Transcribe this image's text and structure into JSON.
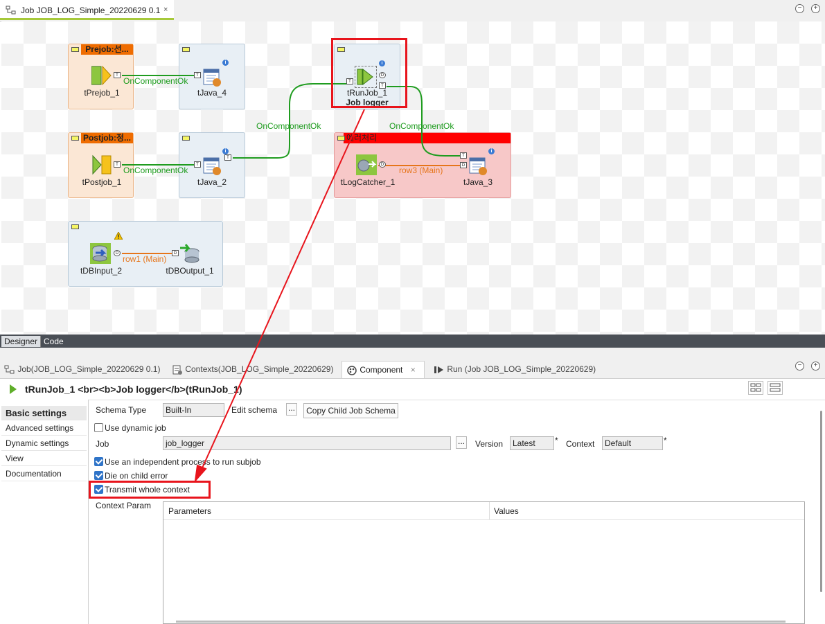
{
  "editor_tab": {
    "title": "Job JOB_LOG_Simple_20220629 0.1",
    "close": "×"
  },
  "window_buttons": {
    "minimize": "−",
    "maximize": "+"
  },
  "canvas": {
    "subjobs": {
      "prejob_title": "Prejob:선...",
      "postjob_title": "Postjob:정...",
      "error_title": "에러처리"
    },
    "components": {
      "tPrejob_1": "tPrejob_1",
      "tJava_4": "tJava_4",
      "tRunJob_1": "tRunJob_1",
      "tRunJob_1_sub": "Job logger",
      "tPostjob_1": "tPostjob_1",
      "tJava_2": "tJava_2",
      "tLogCatcher_1": "tLogCatcher_1",
      "tJava_3": "tJava_3",
      "tDBInput_2": "tDBInput_2",
      "tDBOutput_1": "tDBOutput_1"
    },
    "connections": {
      "pre_ok": "OnComponentOk",
      "post_ok": "OnComponentOk",
      "java2_ok": "OnComponentOk",
      "run_ok": "OnComponentOk",
      "row3": "row3 (Main)",
      "row1": "row1 (Main)"
    },
    "ports": {
      "trigger": "T",
      "data": "D",
      "info": "i"
    },
    "colors": {
      "green_link": "#1f9c1f",
      "orange_link": "#e6751a",
      "highlight_red": "#e8141c",
      "error_header": "#ff0000",
      "pre_header": "#ef6c00"
    }
  },
  "designer_tabs": {
    "designer": "Designer",
    "code": "Code"
  },
  "view_tabs": {
    "job": "Job(JOB_LOG_Simple_20220629 0.1)",
    "contexts": "Contexts(JOB_LOG_Simple_20220629)",
    "component": "Component",
    "component_close": "×",
    "run": "Run (Job JOB_LOG_Simple_20220629)"
  },
  "component_title": "tRunJob_1 <br><b>Job logger</b>(tRunJob_1)",
  "nav": {
    "basic": "Basic settings",
    "advanced": "Advanced settings",
    "dynamic": "Dynamic settings",
    "view": "View",
    "documentation": "Documentation"
  },
  "basic_settings": {
    "schema_type_label": "Schema Type",
    "schema_type_value": "Built-In",
    "edit_schema_label": "Edit schema",
    "ellipsis": "...",
    "copy_child_button": "Copy Child Job Schema",
    "use_dynamic_job": "Use dynamic job",
    "job_label": "Job",
    "job_value": "job_logger",
    "version_label": "Version",
    "version_value": "Latest",
    "context_label": "Context",
    "context_value": "Default",
    "required_mark": "*",
    "independent_process": "Use an independent process to run subjob",
    "die_on_child_error": "Die on child error",
    "transmit_whole_context": "Transmit whole context",
    "context_param_label": "Context Param",
    "col_parameters": "Parameters",
    "col_values": "Values"
  }
}
